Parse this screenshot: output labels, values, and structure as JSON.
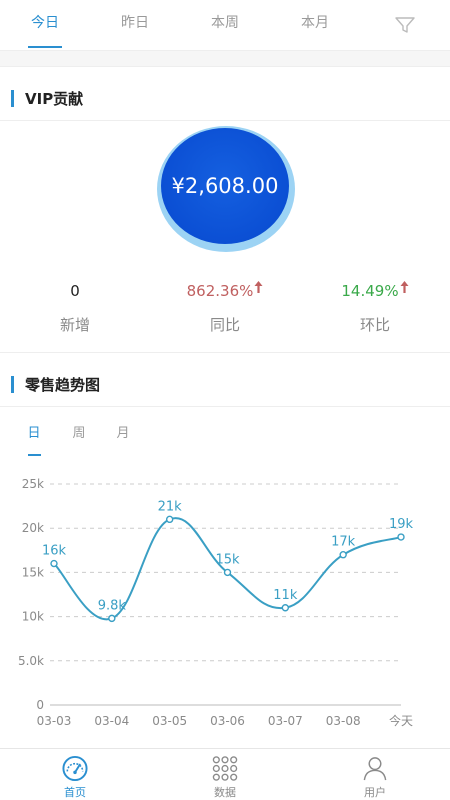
{
  "tabs": [
    {
      "label": "今日",
      "active": true
    },
    {
      "label": "昨日",
      "active": false
    },
    {
      "label": "本周",
      "active": false
    },
    {
      "label": "本月",
      "active": false
    }
  ],
  "filter_icon": "filter-icon",
  "vip": {
    "title": "VIP贡献",
    "amount": "¥2,608.00",
    "stats": [
      {
        "value": "0",
        "label": "新增",
        "color": "#222222",
        "arrow": false
      },
      {
        "value": "862.36%",
        "label": "同比",
        "color": "#c06060",
        "arrow": true
      },
      {
        "value": "14.49%",
        "label": "环比",
        "color": "#3aa94a",
        "arrow": true
      }
    ]
  },
  "trend": {
    "title": "零售趋势图",
    "subtabs": [
      {
        "label": "日",
        "active": true
      },
      {
        "label": "周",
        "active": false
      },
      {
        "label": "月",
        "active": false
      }
    ]
  },
  "chart_data": {
    "type": "line",
    "categories": [
      "03-03",
      "03-04",
      "03-05",
      "03-06",
      "03-07",
      "03-08",
      "今天"
    ],
    "series": [
      {
        "values": [
          16000,
          9800,
          21000,
          15000,
          11000,
          17000,
          19000
        ],
        "labels": [
          "16k",
          "9.8k",
          "21k",
          "15k",
          "11k",
          "17k",
          "19k"
        ]
      }
    ],
    "ylim": [
      0,
      25000
    ],
    "yticks": [
      0,
      5000,
      10000,
      15000,
      20000,
      25000
    ],
    "ytick_labels": [
      "0",
      "5.0k",
      "10k",
      "15k",
      "20k",
      "25k"
    ],
    "grid": true,
    "line_color": "#3a9fc4",
    "title": "",
    "xlabel": "",
    "ylabel": ""
  },
  "bottom_nav": [
    {
      "label": "首页",
      "icon": "speedometer-icon",
      "active": true
    },
    {
      "label": "数据",
      "icon": "grid-dots-icon",
      "active": false
    },
    {
      "label": "用户",
      "icon": "user-icon",
      "active": false
    }
  ],
  "colors": {
    "accent": "#2a8fd0",
    "circle": "#0b4fd4"
  }
}
